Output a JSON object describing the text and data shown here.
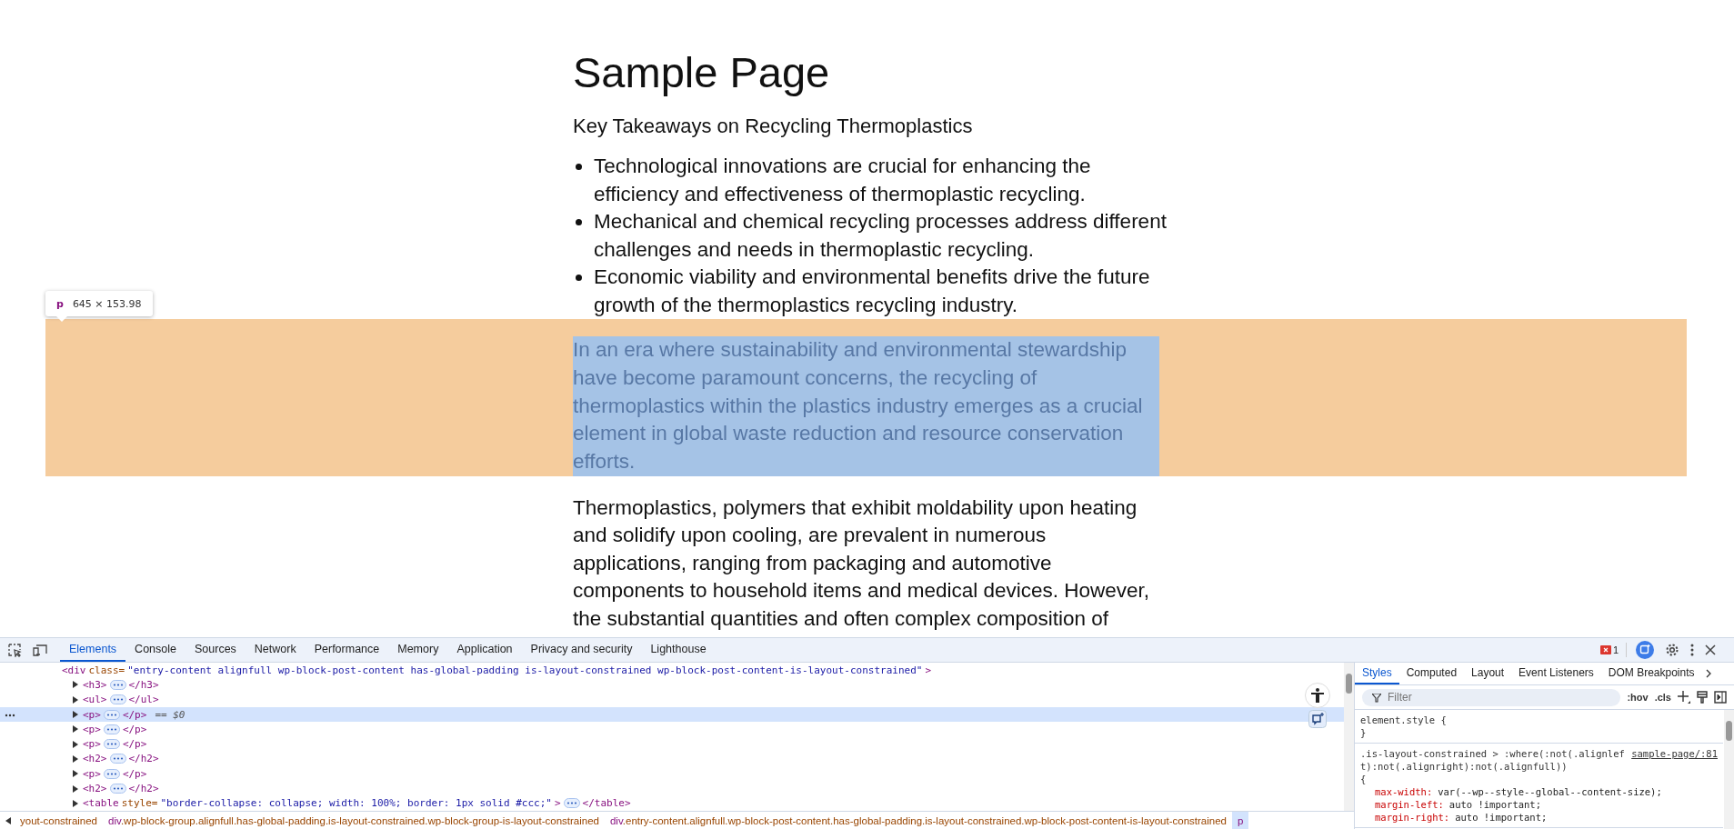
{
  "page": {
    "title": "Sample Page",
    "subtitle": "Key Takeaways on Recycling Thermoplastics",
    "takeaways": [
      "Technological innovations are crucial for enhancing the efficiency and effectiveness of thermoplastic recycling.",
      "Mechanical and chemical recycling processes address different challenges and needs in thermoplastic recycling.",
      "Economic viability and environmental benefits drive the future growth of the thermoplastics recycling industry."
    ],
    "highlighted_paragraph": "In an era where sustainability and environmental stewardship have become paramount concerns, the recycling of thermoplastics within the plastics industry emerges as a crucial element in global waste reduction and resource conservation efforts.",
    "paragraph": "Thermoplastics, polymers that exhibit moldability upon heating and solidify upon cooling, are prevalent in numerous applications, ranging from packaging and automotive components to household items and medical devices. However, the substantial quantities and often complex composition of",
    "inspect_tooltip": {
      "tag": "p",
      "size": "645 × 153.98"
    }
  },
  "devtools": {
    "tabs": [
      {
        "label": "Elements",
        "selected": true
      },
      {
        "label": "Console",
        "selected": false
      },
      {
        "label": "Sources",
        "selected": false
      },
      {
        "label": "Network",
        "selected": false
      },
      {
        "label": "Performance",
        "selected": false
      },
      {
        "label": "Memory",
        "selected": false
      },
      {
        "label": "Application",
        "selected": false
      },
      {
        "label": "Privacy and security",
        "selected": false
      },
      {
        "label": "Lighthouse",
        "selected": false
      }
    ],
    "error_count": "1",
    "dom_rows": [
      {
        "kind": "parent",
        "open": "<div",
        "attr_name": "class=",
        "attr_value": "\"entry-content alignfull wp-block-post-content has-global-padding is-layout-constrained wp-block-post-content-is-layout-constrained\"",
        "open_end": ">",
        "selected": false
      },
      {
        "kind": "child",
        "open": "<h3>",
        "close": "</h3>",
        "selected": false
      },
      {
        "kind": "child",
        "open": "<ul>",
        "close": "</ul>",
        "selected": false
      },
      {
        "kind": "child",
        "open": "<p>",
        "close": "</p>",
        "suffix": "== $0",
        "selected": true
      },
      {
        "kind": "child",
        "open": "<p>",
        "close": "</p>",
        "selected": false
      },
      {
        "kind": "child",
        "open": "<p>",
        "close": "</p>",
        "selected": false
      },
      {
        "kind": "child",
        "open": "<h2>",
        "close": "</h2>",
        "selected": false
      },
      {
        "kind": "child",
        "open": "<p>",
        "close": "</p>",
        "selected": false
      },
      {
        "kind": "child",
        "open": "<h2>",
        "close": "</h2>",
        "selected": false
      },
      {
        "kind": "child",
        "open": "<table",
        "attr_name": "style=",
        "attr_value": "\"border-collapse: collapse; width: 100%; border: 1px solid #ccc;\"",
        "open_end": ">",
        "close": "</table>",
        "selected": false
      }
    ],
    "breadcrumbs": [
      {
        "classes": "yout-constrained",
        "selected": false
      },
      {
        "tag": "div",
        "classes": ".wp-block-group.alignfull.has-global-padding.is-layout-constrained.wp-block-group-is-layout-constrained",
        "selected": false
      },
      {
        "tag": "div",
        "classes": ".entry-content.alignfull.wp-block-post-content.has-global-padding.is-layout-constrained.wp-block-post-content-is-layout-constrained",
        "selected": false
      },
      {
        "tag": "p",
        "selected": true
      }
    ],
    "side_tabs": [
      {
        "label": "Styles",
        "selected": true
      },
      {
        "label": "Computed",
        "selected": false
      },
      {
        "label": "Layout",
        "selected": false
      },
      {
        "label": "Event Listeners",
        "selected": false
      },
      {
        "label": "DOM Breakpoints",
        "selected": false
      }
    ],
    "filter": {
      "placeholder": "Filter"
    },
    "filter_buttons": [
      ":hov",
      ".cls"
    ],
    "element_style": {
      "open": "element.style {",
      "close": "}"
    },
    "rule": {
      "selector": ".is-layout-constrained > :where(:not(.alignleft):not(.alignright):not(.alignfull))",
      "source": "sample-page/:81",
      "open": "{",
      "declarations": [
        {
          "property": "max-width:",
          "value": "var(--wp--style--global--content-size);"
        },
        {
          "property": "margin-left:",
          "value": "auto !important;"
        },
        {
          "property": "margin-right:",
          "value": "auto !important;"
        }
      ]
    }
  }
}
